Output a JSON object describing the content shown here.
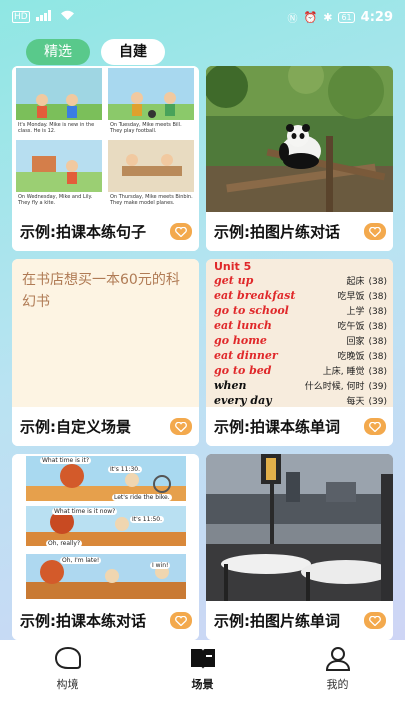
{
  "status_bar": {
    "network": "HD",
    "signal": "4G",
    "battery": "61",
    "time": "4:29"
  },
  "tabs": [
    {
      "label": "精选",
      "active": true
    },
    {
      "label": "自建",
      "active": false
    }
  ],
  "cards": [
    {
      "label": "示例:拍课本练句子",
      "image": "comic-book-page"
    },
    {
      "label": "示例:拍图片练对话",
      "image": "panda-photo"
    },
    {
      "label": "示例:自定义场景",
      "text": "在书店想买一本60元的科幻书"
    },
    {
      "label": "示例:拍课本练单词",
      "image": "vocab-list-page",
      "vocab_heading": "Unit 5",
      "vocab": [
        {
          "en": "get up",
          "zh": "起床",
          "page": "(38)"
        },
        {
          "en": "eat breakfast",
          "zh": "吃早饭",
          "page": "(38)"
        },
        {
          "en": "go to school",
          "zh": "上学",
          "page": "(38)"
        },
        {
          "en": "eat lunch",
          "zh": "吃午饭",
          "page": "(38)"
        },
        {
          "en": "go home",
          "zh": "回家",
          "page": "(38)"
        },
        {
          "en": "eat dinner",
          "zh": "吃晚饭",
          "page": "(38)"
        },
        {
          "en": "go to bed",
          "zh": "上床, 睡觉",
          "page": "(38)"
        },
        {
          "en": "when",
          "zh": "什么时候, 何时",
          "page": "(39)"
        },
        {
          "en": "every day",
          "zh": "每天",
          "page": "(39)"
        }
      ]
    },
    {
      "label": "示例:拍课本练对话",
      "image": "comic-dialogue-page",
      "bubbles": [
        "What time is it?",
        "It's 11:30.",
        "Let's ride the bike.",
        "What time is it now?",
        "It's 11:50.",
        "Oh, really?",
        "Oh, I'm late!",
        "I win!"
      ]
    },
    {
      "label": "示例:拍图片练单词",
      "image": "restaurant-photo"
    }
  ],
  "comic_captions": [
    "It's Monday. Mike is new in the class. He is 12.",
    "On Tuesday, Mike meets Bill. They play football.",
    "On Wednesday, Mike and Lily. They fly a kite.",
    "On Thursday, Mike meets Binbin. They make model planes."
  ],
  "bottom_nav": [
    {
      "label": "构境",
      "icon": "chat-bubble-icon",
      "active": false
    },
    {
      "label": "场景",
      "icon": "book-icon",
      "active": true
    },
    {
      "label": "我的",
      "icon": "person-icon",
      "active": false
    }
  ],
  "colors": {
    "accent_green": "#59c98b",
    "heart_orange": "#f3a94d",
    "vocab_red": "#e0282a"
  }
}
